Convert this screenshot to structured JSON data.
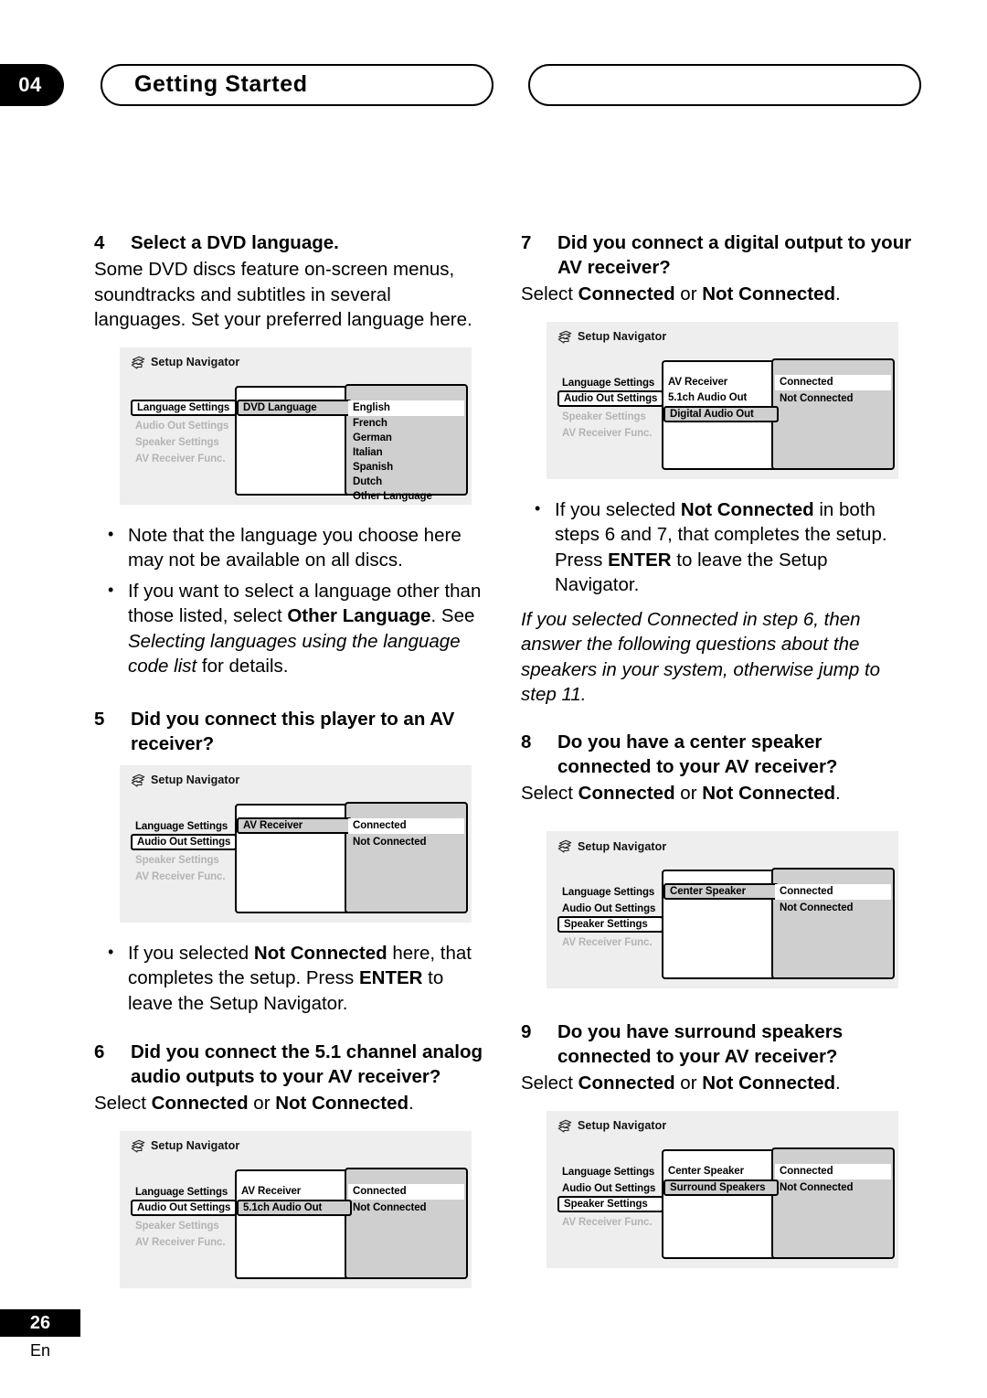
{
  "header": {
    "chapter_number": "04",
    "title": "Getting Started"
  },
  "footer": {
    "page_number": "26",
    "language_code": "En"
  },
  "osd": {
    "title": "Setup Navigator",
    "icon": "setup-navigator-icon"
  },
  "left_column": {
    "step4": {
      "number": "4",
      "heading": "Select a DVD language.",
      "body": "Some DVD discs feature on-screen menus, soundtracks and subtitles in several languages. Set your preferred language here."
    },
    "screen_dvd_language": {
      "left_menu": [
        {
          "label": "Language Settings",
          "state": "active"
        },
        {
          "label": "Audio Out Settings",
          "state": "dim"
        },
        {
          "label": "Speaker Settings",
          "state": "dim"
        },
        {
          "label": "AV Receiver Func.",
          "state": "dim"
        }
      ],
      "mid_menu": [
        {
          "label": "DVD Language",
          "state": "selected"
        }
      ],
      "right_options": [
        {
          "label": "English",
          "state": "highlighted"
        },
        {
          "label": "French",
          "state": "normal"
        },
        {
          "label": "German",
          "state": "normal"
        },
        {
          "label": "Italian",
          "state": "normal"
        },
        {
          "label": "Spanish",
          "state": "normal"
        },
        {
          "label": "Dutch",
          "state": "normal"
        },
        {
          "label": "Other Language",
          "state": "normal"
        }
      ]
    },
    "bullets_after_step4": [
      {
        "parts": [
          {
            "text": "Note that the language you choose here may not be available on all discs.",
            "style": "normal"
          }
        ]
      },
      {
        "parts": [
          {
            "text": "If you want to select a language other than those listed, select ",
            "style": "normal"
          },
          {
            "text": "Other Language",
            "style": "bold"
          },
          {
            "text": ". See ",
            "style": "normal"
          },
          {
            "text": "Selecting languages using the language code list",
            "style": "italic"
          },
          {
            "text": " for details.",
            "style": "normal"
          }
        ]
      }
    ],
    "step5": {
      "number": "5",
      "heading": "Did you connect this player to an AV receiver?"
    },
    "screen_av_receiver": {
      "left_menu": [
        {
          "label": "Language Settings",
          "state": "normal"
        },
        {
          "label": "Audio Out Settings",
          "state": "active"
        },
        {
          "label": "Speaker Settings",
          "state": "dim"
        },
        {
          "label": "AV Receiver Func.",
          "state": "dim"
        }
      ],
      "mid_menu": [
        {
          "label": "AV Receiver",
          "state": "selected"
        }
      ],
      "right_options": [
        {
          "label": "Connected",
          "state": "highlighted"
        },
        {
          "label": "Not Connected",
          "state": "normal"
        }
      ]
    },
    "bullets_after_step5": [
      {
        "parts": [
          {
            "text": "If you selected ",
            "style": "normal"
          },
          {
            "text": "Not Connected",
            "style": "bold"
          },
          {
            "text": " here, that completes the setup. Press ",
            "style": "normal"
          },
          {
            "text": "ENTER",
            "style": "bold"
          },
          {
            "text": " to leave the Setup Navigator.",
            "style": "normal"
          }
        ]
      }
    ],
    "step6": {
      "number": "6",
      "heading": "Did you connect the 5.1 channel analog audio outputs to your AV receiver?",
      "select_prefix": "Select ",
      "option_a": "Connected",
      "select_middle": " or ",
      "option_b": "Not Connected",
      "select_suffix": "."
    },
    "screen_51ch": {
      "left_menu": [
        {
          "label": "Language Settings",
          "state": "normal"
        },
        {
          "label": "Audio Out Settings",
          "state": "active"
        },
        {
          "label": "Speaker Settings",
          "state": "dim"
        },
        {
          "label": "AV Receiver Func.",
          "state": "dim"
        }
      ],
      "mid_menu": [
        {
          "label": "AV Receiver",
          "state": "normal"
        },
        {
          "label": "5.1ch Audio Out",
          "state": "selected"
        }
      ],
      "right_options": [
        {
          "label": "Connected",
          "state": "highlighted"
        },
        {
          "label": "Not Connected",
          "state": "normal"
        }
      ]
    }
  },
  "right_column": {
    "step7": {
      "number": "7",
      "heading": "Did you connect a digital output to your AV receiver?",
      "select_prefix": "Select ",
      "option_a": "Connected",
      "select_middle": " or ",
      "option_b": "Not Connected",
      "select_suffix": "."
    },
    "screen_digital_audio_out": {
      "left_menu": [
        {
          "label": "Language Settings",
          "state": "normal"
        },
        {
          "label": "Audio Out Settings",
          "state": "active"
        },
        {
          "label": "Speaker Settings",
          "state": "dim"
        },
        {
          "label": "AV Receiver Func.",
          "state": "dim"
        }
      ],
      "mid_menu": [
        {
          "label": "AV Receiver",
          "state": "normal"
        },
        {
          "label": "5.1ch Audio Out",
          "state": "normal"
        },
        {
          "label": "Digital Audio Out",
          "state": "selected"
        }
      ],
      "right_options": [
        {
          "label": "Connected",
          "state": "highlighted"
        },
        {
          "label": "Not Connected",
          "state": "normal"
        }
      ]
    },
    "bullets_after_step7": [
      {
        "parts": [
          {
            "text": "If you selected ",
            "style": "normal"
          },
          {
            "text": "Not Connected",
            "style": "bold"
          },
          {
            "text": " in both steps 6 and 7, that completes the setup. Press ",
            "style": "normal"
          },
          {
            "text": "ENTER",
            "style": "bold"
          },
          {
            "text": " to leave the Setup Navigator.",
            "style": "normal"
          }
        ]
      }
    ],
    "italic_note": "If you selected Connected in step 6, then answer the following questions about the speakers in your system, otherwise jump to step 11.",
    "step8": {
      "number": "8",
      "heading": "Do you have a center speaker connected to your AV receiver?",
      "select_prefix": "Select ",
      "option_a": "Connected",
      "select_middle": " or ",
      "option_b": "Not Connected",
      "select_suffix": "."
    },
    "screen_center_speaker": {
      "left_menu": [
        {
          "label": "Language Settings",
          "state": "normal"
        },
        {
          "label": "Audio Out Settings",
          "state": "normal"
        },
        {
          "label": "Speaker Settings",
          "state": "active"
        },
        {
          "label": "AV Receiver Func.",
          "state": "dim"
        }
      ],
      "mid_menu": [
        {
          "label": "Center Speaker",
          "state": "selected"
        }
      ],
      "right_options": [
        {
          "label": "Connected",
          "state": "highlighted"
        },
        {
          "label": "Not Connected",
          "state": "normal"
        }
      ]
    },
    "step9": {
      "number": "9",
      "heading": "Do you have surround speakers connected to your AV receiver?",
      "select_prefix": "Select ",
      "option_a": "Connected",
      "select_middle": " or ",
      "option_b": "Not Connected",
      "select_suffix": "."
    },
    "screen_surround_speakers": {
      "left_menu": [
        {
          "label": "Language Settings",
          "state": "normal"
        },
        {
          "label": "Audio Out Settings",
          "state": "normal"
        },
        {
          "label": "Speaker Settings",
          "state": "active"
        },
        {
          "label": "AV Receiver Func.",
          "state": "dim"
        }
      ],
      "mid_menu": [
        {
          "label": "Center Speaker",
          "state": "normal"
        },
        {
          "label": "Surround Speakers",
          "state": "selected"
        }
      ],
      "right_options": [
        {
          "label": "Connected",
          "state": "highlighted"
        },
        {
          "label": "Not Connected",
          "state": "normal"
        }
      ]
    }
  }
}
